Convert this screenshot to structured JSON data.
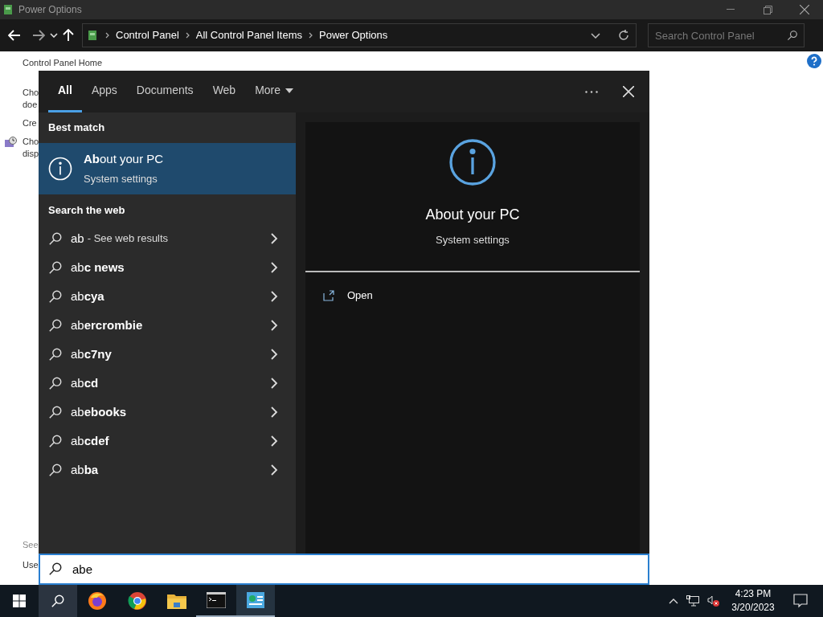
{
  "window": {
    "title": "Power Options"
  },
  "address_bar": {
    "breadcrumbs": [
      "Control Panel",
      "All Control Panel Items",
      "Power Options"
    ],
    "search_placeholder": "Search Control Panel"
  },
  "left_panel": {
    "top_items": [
      "Control Panel Home"
    ],
    "links": [
      {
        "lines": [
          "Cho",
          "doe"
        ],
        "icon": false
      },
      {
        "lines": [
          "Cre"
        ],
        "icon": false
      },
      {
        "lines": [
          "Cho",
          "disp"
        ],
        "icon": true
      }
    ],
    "bottom_items": [
      "See",
      "Use"
    ]
  },
  "search_flyout": {
    "tabs": [
      {
        "label": "All",
        "selected": true
      },
      {
        "label": "Apps",
        "selected": false
      },
      {
        "label": "Documents",
        "selected": false
      },
      {
        "label": "Web",
        "selected": false
      },
      {
        "label": "More",
        "selected": false
      }
    ],
    "best_match_heading": "Best match",
    "best_match": {
      "title": "**Ab**out your PC",
      "subtitle": "System settings",
      "selected": true
    },
    "web_heading": "Search the web",
    "web_results": [
      {
        "text": "ab",
        "suffix": "- See web results"
      },
      {
        "text": "ab**c news**"
      },
      {
        "text": "ab**cya**"
      },
      {
        "text": "ab**ercrombie**"
      },
      {
        "text": "ab**c7ny**"
      },
      {
        "text": "ab**cd**"
      },
      {
        "text": "ab**ebooks**"
      },
      {
        "text": "ab**cdef**"
      },
      {
        "text": "ab**ba**"
      }
    ],
    "preview": {
      "title": "About your PC",
      "subtitle": "System settings",
      "actions": [
        "Open"
      ]
    },
    "query": "abe"
  },
  "taskbar": {
    "time": "4:23 PM",
    "date": "3/20/2023"
  }
}
